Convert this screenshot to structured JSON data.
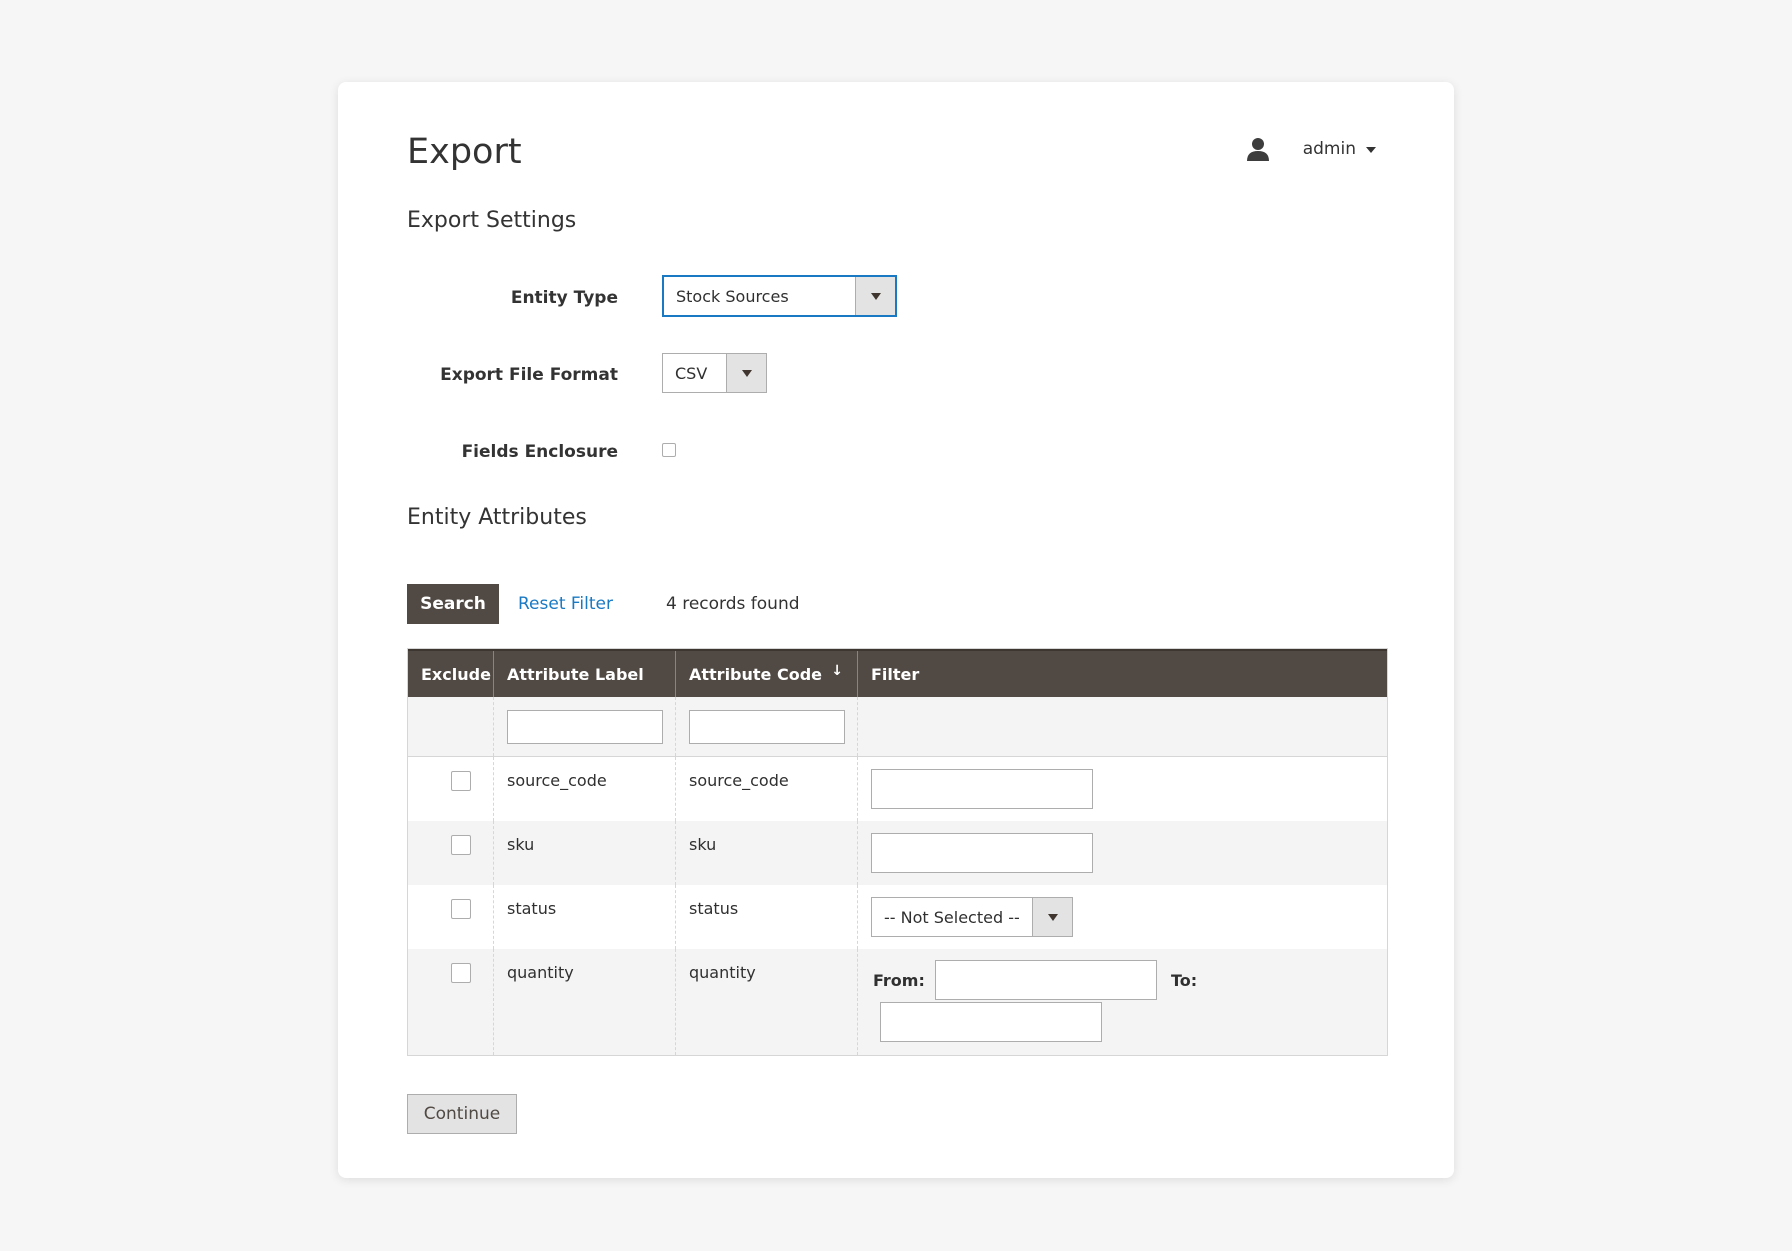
{
  "page": {
    "title": "Export"
  },
  "user_menu": {
    "username": "admin"
  },
  "export_settings": {
    "heading": "Export Settings",
    "entity_type": {
      "label": "Entity Type",
      "value": "Stock Sources"
    },
    "file_format": {
      "label": "Export File Format",
      "value": "CSV"
    },
    "fields_enclosure": {
      "label": "Fields Enclosure",
      "checked": false
    }
  },
  "entity_attributes": {
    "heading": "Entity Attributes",
    "search_label": "Search",
    "reset_label": "Reset Filter",
    "records_found": "4 records found",
    "columns": {
      "exclude": "Exclude",
      "attribute_label": "Attribute Label",
      "attribute_code": "Attribute Code",
      "filter": "Filter"
    },
    "sort_indicator": "↓",
    "rows": [
      {
        "label": "source_code",
        "code": "source_code",
        "filter_type": "text"
      },
      {
        "label": "sku",
        "code": "sku",
        "filter_type": "text"
      },
      {
        "label": "status",
        "code": "status",
        "filter_type": "select",
        "filter_value": "-- Not Selected --"
      },
      {
        "label": "quantity",
        "code": "quantity",
        "filter_type": "range",
        "from_label": "From:",
        "to_label": "To:"
      }
    ]
  },
  "continue_label": "Continue",
  "colors": {
    "header_bg": "#514943",
    "link": "#1979c3",
    "focus_border": "#1979c3",
    "page_bg": "#f6f6f6"
  }
}
